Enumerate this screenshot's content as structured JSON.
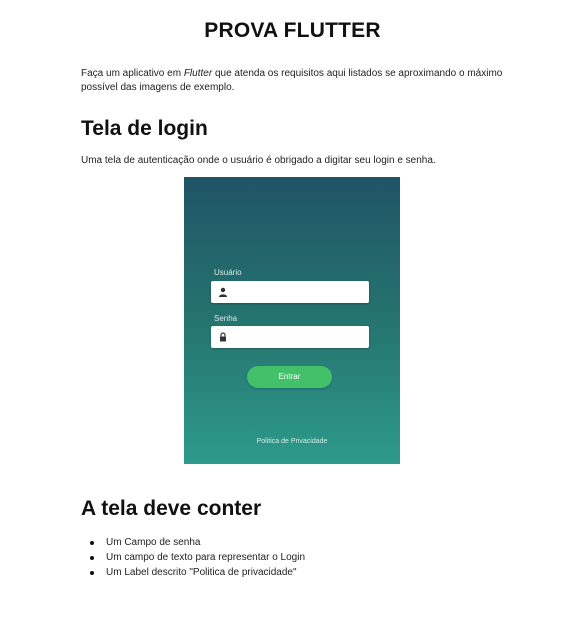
{
  "document": {
    "title": "PROVA FLUTTER",
    "intro": {
      "before": "Faça um aplicativo em ",
      "emphasis": "Flutter",
      "after": " que atenda os requisitos aqui listados se aproximando o máximo possível das imagens de exemplo."
    },
    "login_section": {
      "heading": "Tela de login",
      "description": "Uma tela de autenticação onde o usuário é obrigado a digitar seu login e senha."
    },
    "mockup": {
      "username_label": "Usuário",
      "username_icon": "user-icon",
      "password_label": "Senha",
      "password_icon": "lock-icon",
      "login_button": "Entrar",
      "policy_link": "Politica de Privacidade",
      "colors": {
        "gradient_top": "#1f5466",
        "gradient_bottom": "#2d9a8c",
        "button": "#43c06a"
      }
    },
    "requirements_section": {
      "heading": "A tela deve conter",
      "items": [
        "Um Campo de senha",
        "Um campo de texto para representar o Login",
        "Um Label descrito \"Politica de privacidade\""
      ]
    }
  }
}
